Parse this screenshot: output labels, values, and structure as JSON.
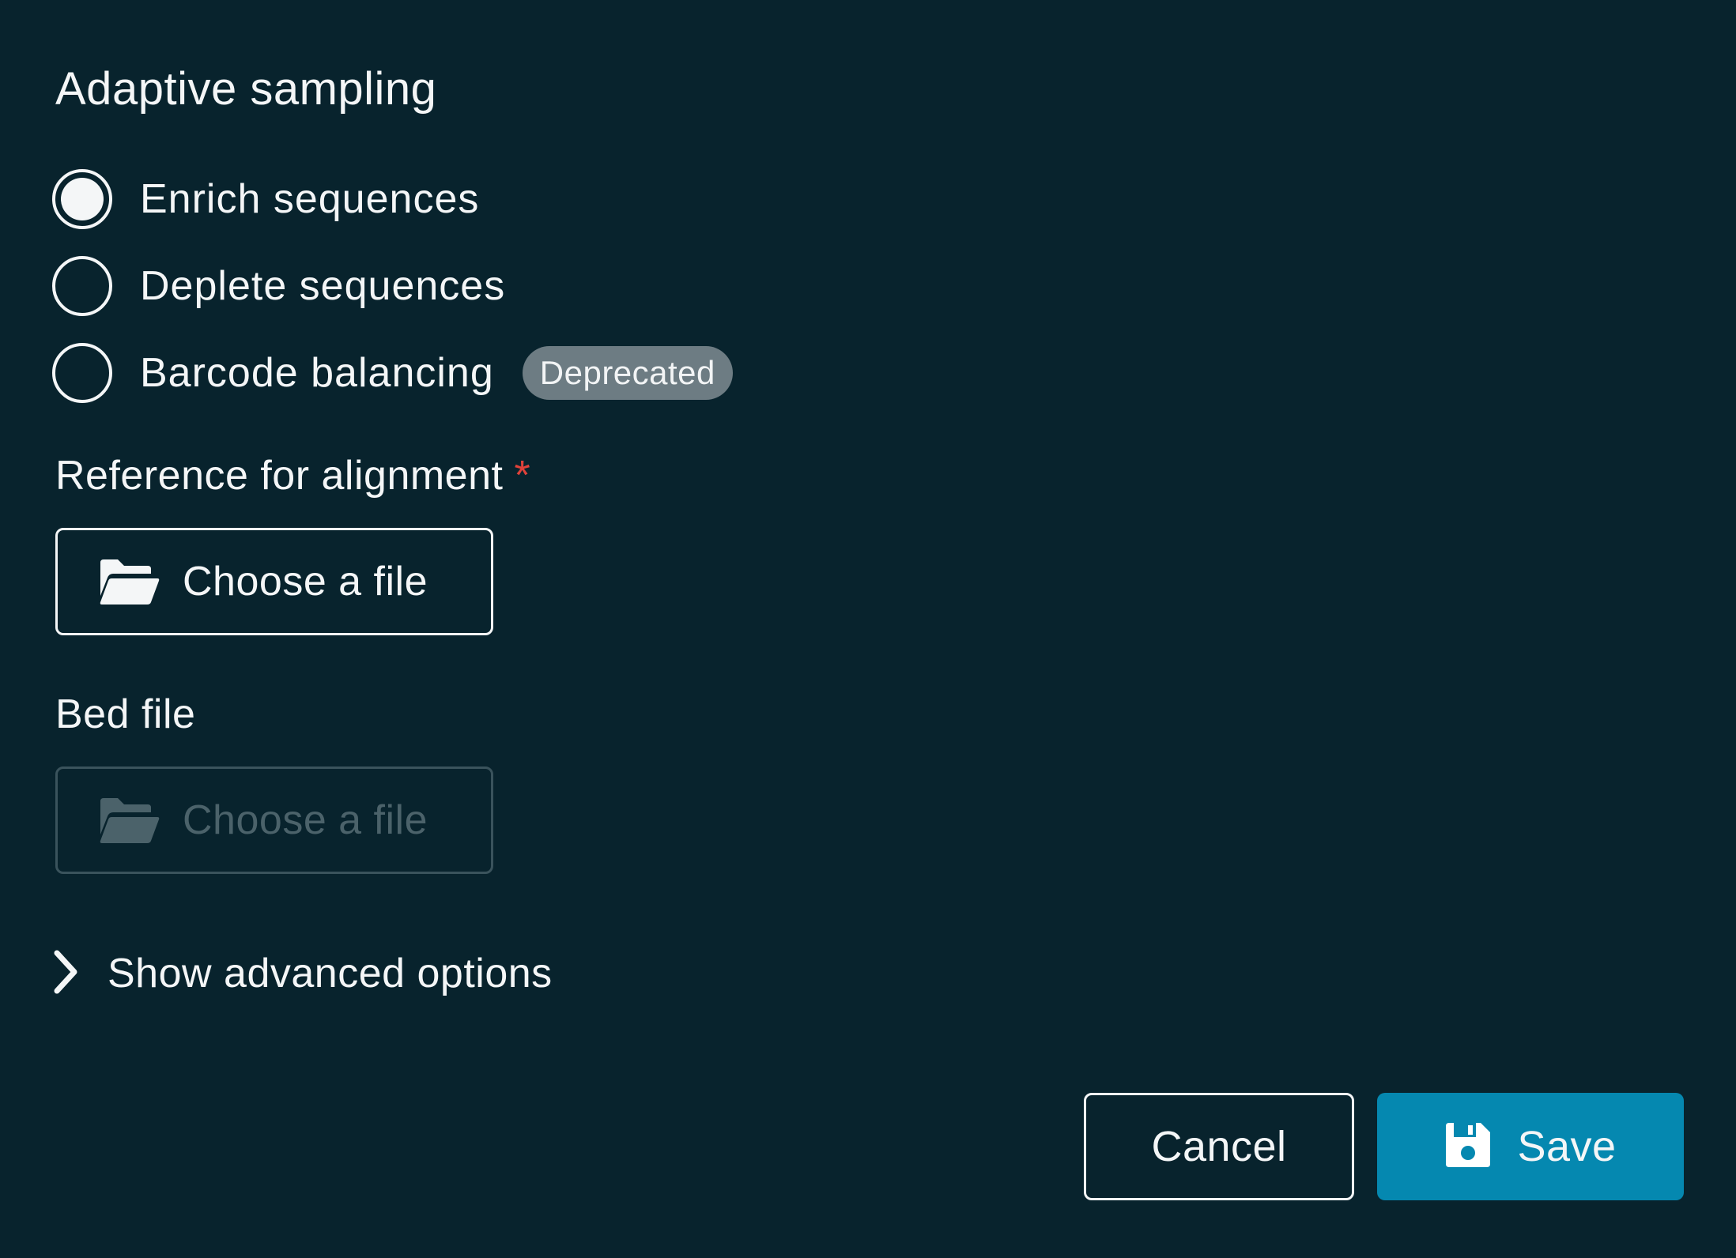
{
  "dialog": {
    "section_title": "Adaptive sampling",
    "mode_options": [
      {
        "label": "Enrich sequences",
        "selected": true
      },
      {
        "label": "Deplete sequences",
        "selected": false
      },
      {
        "label": "Barcode balancing",
        "selected": false,
        "badge": "Deprecated"
      }
    ],
    "reference": {
      "label": "Reference for alignment",
      "required_marker": "*",
      "button_label": "Choose a file",
      "icon": "folder-open-icon"
    },
    "bed_file": {
      "label": "Bed file",
      "button_label": "Choose a file",
      "icon": "folder-open-icon",
      "disabled": true
    },
    "advanced": {
      "label": "Show advanced options",
      "icon": "chevron-right-icon",
      "expanded": false
    },
    "actions": {
      "cancel_label": "Cancel",
      "save_label": "Save",
      "save_icon": "floppy-disk-icon"
    }
  },
  "colors": {
    "background": "#08232d",
    "text": "#f4f6f7",
    "primary": "#0588b0",
    "required": "#e0423a",
    "badge": "#6d7c83",
    "disabled_text": "#4b626a",
    "disabled_border": "#3a535c"
  }
}
